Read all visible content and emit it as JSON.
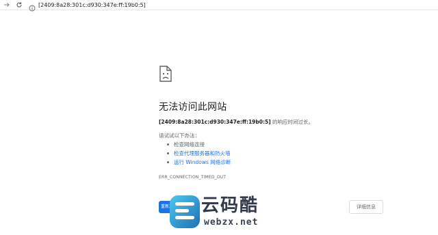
{
  "toolbar": {
    "url": "[2409:8a28:301c:d930:347e:ff:19b0:5]",
    "back_icon": "arrow-right-icon",
    "reload_icon": "reload-icon",
    "info_icon": "info-icon"
  },
  "error_page": {
    "icon": "sad-page-icon",
    "heading": "无法访问此网站",
    "detail_host": "[2409:8a28:301c:d930:347e:ff:19b0:5]",
    "detail_suffix": " 的响应时间过长。",
    "suggestions_title": "请试试以下办法：",
    "suggestions": [
      {
        "label": "检查网络连接",
        "link": false
      },
      {
        "label": "检查代理服务器和防火墙",
        "link": true
      },
      {
        "label": "运行 Windows 网络诊断",
        "link": true
      }
    ],
    "error_code": "ERR_CONNECTION_TIMED_OUT",
    "reload_button": "重新加载",
    "details_button": "详细信息"
  },
  "watermark": {
    "title": "云码酷",
    "domain": "webzx.net",
    "colors": {
      "logo_blue": "#2fb4e8",
      "logo_dark": "#1f6fb5",
      "text": "#333b4a"
    }
  },
  "colors": {
    "link": "#1a73e8",
    "primary_button": "#1a73e8",
    "secondary_text": "#5f6368"
  }
}
